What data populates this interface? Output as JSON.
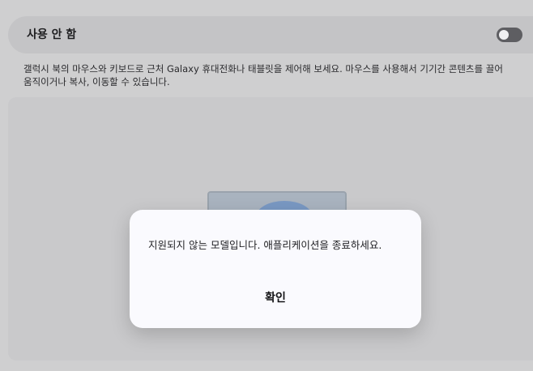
{
  "setting": {
    "toggle_label": "사용 안 함",
    "toggle_state": "off",
    "description": "갤럭시 북의 마우스와 키보드로 근처 Galaxy 휴대전화나 태블릿을 제어해 보세요. 마우스를 사용해서 기기간 콘텐츠를 끌어 움직이거나 복사, 이동할 수 있습니다."
  },
  "dialog": {
    "message": "지원되지 않는 모델입니다. 애플리케이션을 종료하세요.",
    "confirm_label": "확인"
  },
  "colors": {
    "toggle_track": "#5e5e62",
    "dialog_background": "#fafafe",
    "overlay_background": "#cfcfd0"
  }
}
